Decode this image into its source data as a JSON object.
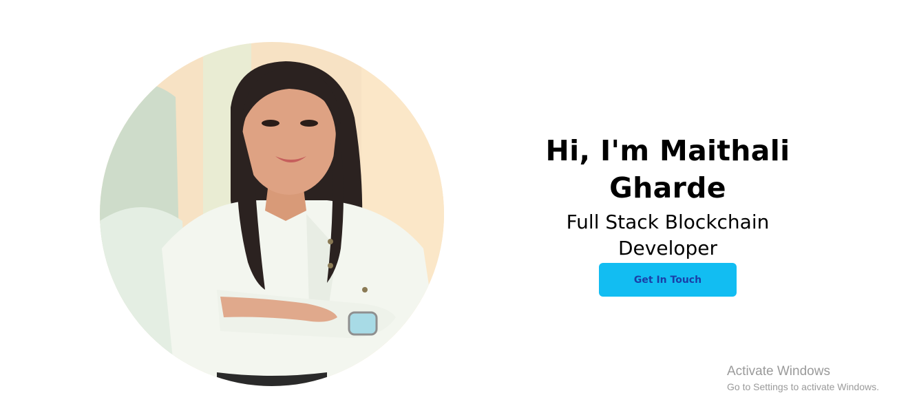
{
  "hero": {
    "name": "Hi, I'm Maithali Gharde",
    "role": "Full Stack Blockchain Developer",
    "cta_label": "Get In Touch",
    "accent_color": "#12bdf2",
    "cta_text_color": "#1a3fa8",
    "photo_icon": "profile-photo"
  },
  "watermark": {
    "title": "Activate Windows",
    "subtitle": "Go to Settings to activate Windows."
  }
}
